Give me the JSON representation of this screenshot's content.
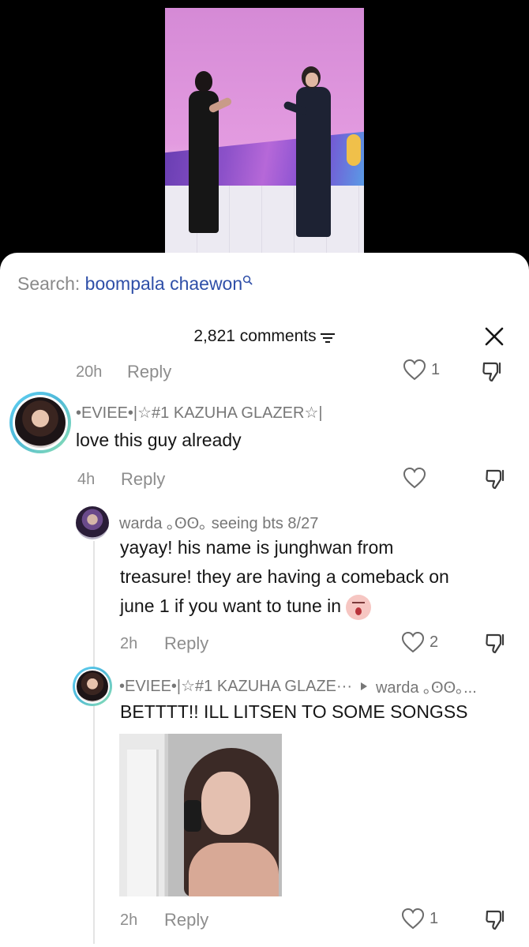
{
  "search": {
    "prefix": "Search:",
    "term": "boompala chaewon"
  },
  "header": {
    "count_label": "2,821 comments"
  },
  "prev_comment": {
    "time": "20h",
    "reply_label": "Reply",
    "likes": "1"
  },
  "comments": [
    {
      "username": "•EVIEE•|☆#1 KAZUHA GLAZER☆|",
      "text": "love this guy already",
      "time": "4h",
      "reply_label": "Reply"
    },
    {
      "username": "warda ｡ʘʘ｡ seeing bts 8/27",
      "text_lines": [
        "yayay! his name is junghwan from",
        "treasure! they are having a comeback on",
        "june 1 if you want to tune in"
      ],
      "time": "2h",
      "reply_label": "Reply",
      "likes": "2"
    },
    {
      "username": "•EVIEE•|☆#1 KAZUHA GLAZE···",
      "reply_to": "warda ｡ʘʘ｡...",
      "text": "BETTTT!! ILL LITSEN TO SOME SONGSS",
      "time": "2h",
      "reply_label": "Reply",
      "likes": "1"
    }
  ]
}
